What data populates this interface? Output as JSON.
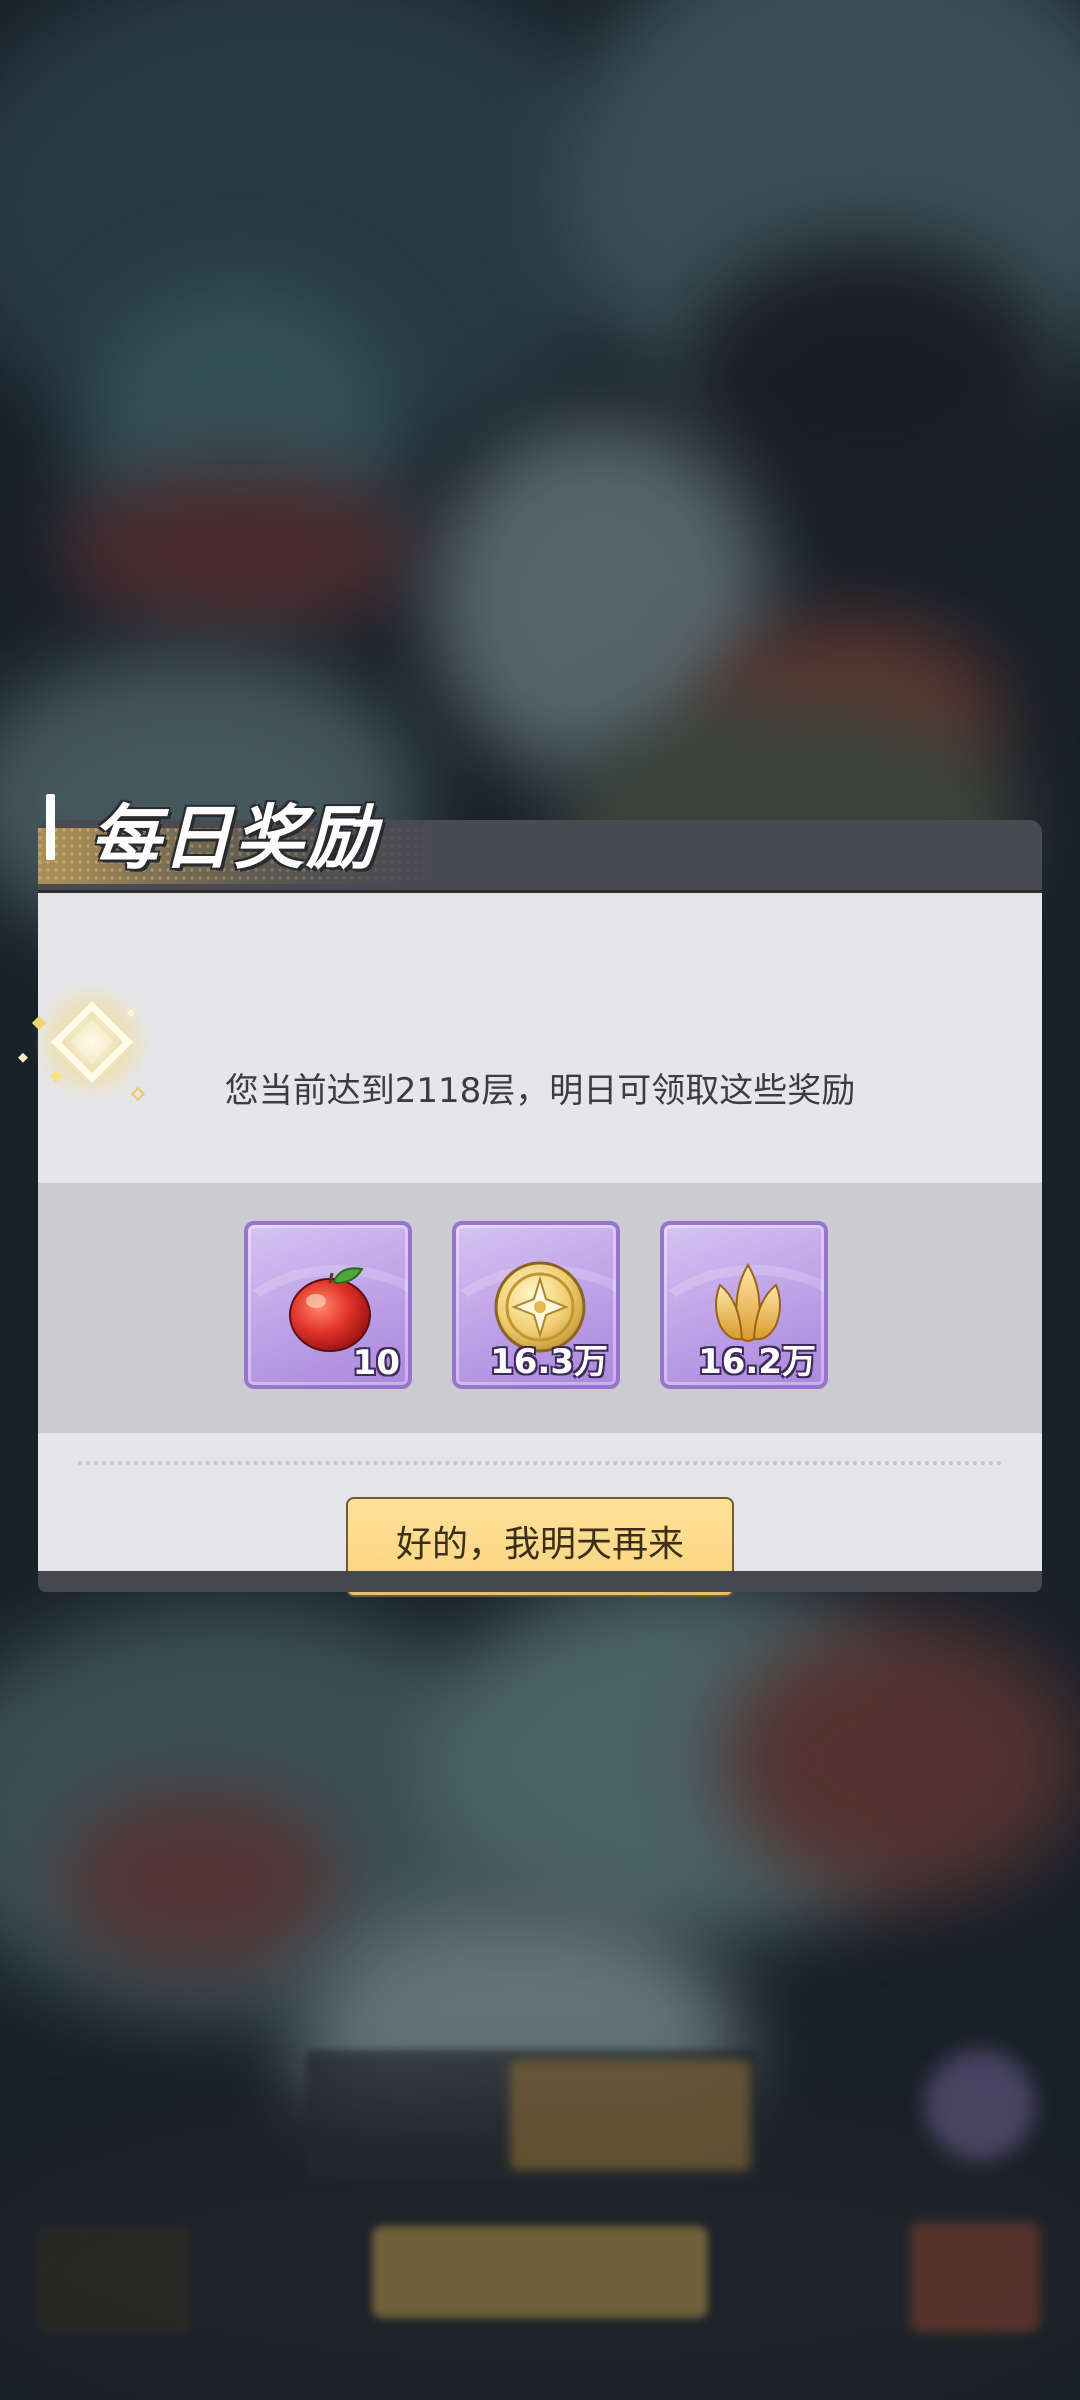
{
  "dialog": {
    "title": "每日奖励",
    "message": "您当前达到2118层，明日可领取这些奖励",
    "rewards": [
      {
        "icon": "red-fruit-icon",
        "quantity": "10"
      },
      {
        "icon": "gold-coin-icon",
        "quantity": "16.3万"
      },
      {
        "icon": "golden-lotus-icon",
        "quantity": "16.2万"
      }
    ],
    "confirm_label": "好的，我明天再来"
  },
  "colors": {
    "header": "#4a4b52",
    "body": "#e6e6e8",
    "reward_band": "#cbcbd0",
    "reward_tile": "#bda0e6",
    "button": "#f8d37a"
  }
}
